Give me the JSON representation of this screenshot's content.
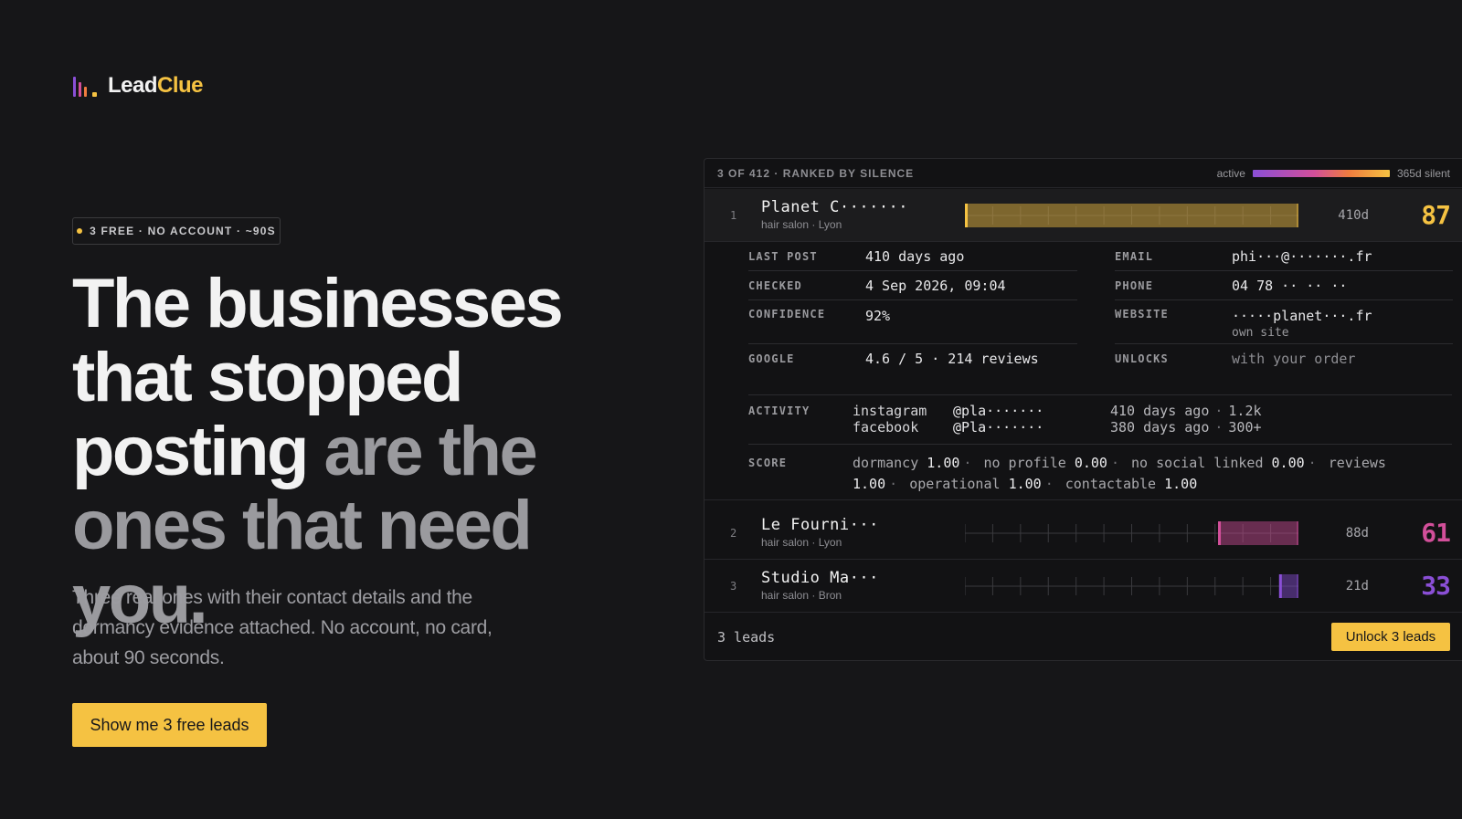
{
  "brand": {
    "name_part1": "Lead",
    "name_part2": "Clue",
    "mark_colors": [
      "#8a4fd6",
      "#d24f9a",
      "#ef7c3f",
      "#f5c242"
    ]
  },
  "hero": {
    "badge": "3 FREE · NO ACCOUNT · ~90S",
    "headline_part1": "The businesses that stopped posting",
    "headline_part2": " are the ones that need you.",
    "subtext": "Three real ones with their contact details and the dormancy evidence attached. No account, no card, about 90 seconds.",
    "cta_label": "Show me 3 free leads"
  },
  "panel": {
    "title": "3 OF 412 · RANKED BY SILENCE",
    "legend_start": "active",
    "legend_end": "365d silent",
    "rows": [
      {
        "rank": "1",
        "name": "Planet C·······",
        "subtitle": "hair salon · Lyon",
        "days": "410d",
        "score": "87",
        "silence_fraction": 1.0,
        "color": "#f5c242",
        "active": true
      },
      {
        "rank": "2",
        "name": "Le Fourni···",
        "subtitle": "hair salon · Lyon",
        "days": "88d",
        "score": "61",
        "silence_fraction": 0.241,
        "color": "#d24f9a",
        "active": false
      },
      {
        "rank": "3",
        "name": "Studio Ma···",
        "subtitle": "hair salon · Bron",
        "days": "21d",
        "score": "33",
        "silence_fraction": 0.058,
        "color": "#8a4fd6",
        "active": false
      }
    ],
    "detail": {
      "last_post_label": "LAST POST",
      "last_post_value": "410 days ago",
      "checked_label": "CHECKED",
      "checked_value": "4 Sep 2026, 09:04",
      "confidence_label": "CONFIDENCE",
      "confidence_value": "92%",
      "google_label": "GOOGLE",
      "google_value": "4.6 / 5 · 214 reviews",
      "email_label": "EMAIL",
      "email_value": "phi···@·······.fr",
      "phone_label": "PHONE",
      "phone_value": "04 78 ·· ·· ··",
      "website_label": "WEBSITE",
      "website_value": "·····planet···.fr",
      "website_note": "own site",
      "unlocks_label": "UNLOCKS",
      "unlocks_value": "with your order",
      "activity_label": "ACTIVITY",
      "activity": [
        {
          "network": "instagram",
          "handle": "@pla·······",
          "ago": "410 days ago",
          "count": "1.2k"
        },
        {
          "network": "facebook",
          "handle": "@Pla·······",
          "ago": "380 days ago",
          "count": "300+"
        }
      ],
      "score_label": "SCORE",
      "score_parts": [
        {
          "name": "dormancy",
          "value": "1.00"
        },
        {
          "name": "no profile",
          "value": "0.00"
        },
        {
          "name": "no social linked",
          "value": "0.00"
        },
        {
          "name": "reviews",
          "value": "1.00"
        },
        {
          "name": "operational",
          "value": "1.00"
        },
        {
          "name": "contactable",
          "value": "1.00"
        }
      ]
    },
    "footer_count": "3 leads",
    "unlock_label": "Unlock 3 leads"
  }
}
